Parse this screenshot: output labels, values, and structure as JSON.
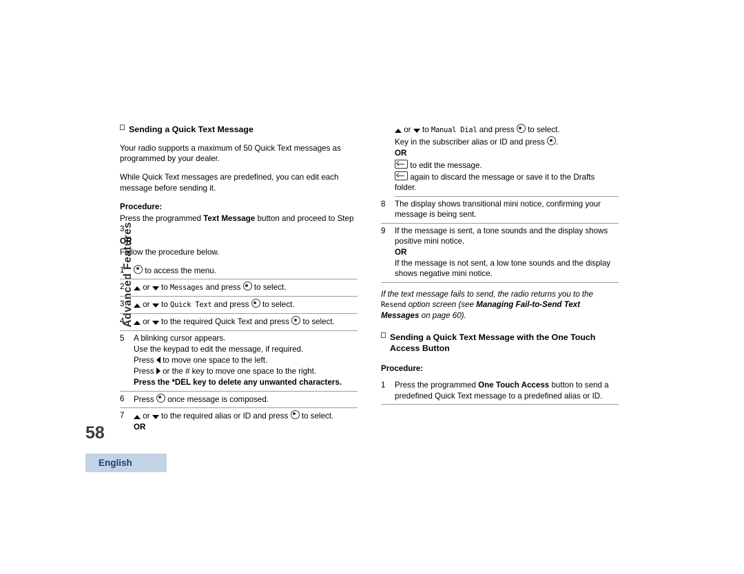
{
  "page": {
    "number": "58",
    "side_tab": "Advanced Features",
    "language_tab": "English"
  },
  "left_column": {
    "section_title": "Sending a Quick Text Message",
    "intro_1": "Your radio supports a maximum of 50 Quick Text messages as programmed by your dealer.",
    "intro_2": "While Quick Text messages are predefined, you can edit each message before sending it.",
    "procedure_label": "Procedure:",
    "proc_intro_a": "Press the programmed ",
    "proc_intro_b": "Text Message",
    "proc_intro_c": " button and proceed to Step 3.",
    "or": "OR",
    "proc_follow": "Follow the procedure below.",
    "steps": [
      {
        "num": "1",
        "text_after_key": " to access the menu."
      },
      {
        "num": "2",
        "pre": " or ",
        "mid": " to ",
        "mono": "Messages",
        "post": " and press ",
        "end": " to select."
      },
      {
        "num": "3",
        "pre": " or ",
        "mid": " to ",
        "mono": "Quick Text",
        "post": " and press ",
        "end": " to select."
      },
      {
        "num": "4",
        "pre": " or ",
        "mid": " to the required Quick Text and press ",
        "end": " to select."
      },
      {
        "num": "5",
        "lines": [
          "A blinking cursor appears.",
          "Use the keypad to edit the message, if required.",
          "Press  to move one space to the left.",
          "Press  or the # key to move one space to the right.",
          "Press the *DEL key to delete any unwanted characters."
        ],
        "line3_a": "Press ",
        "line3_b": " to move one space to the left.",
        "line4_a": "Press ",
        "line4_b": " or the # key to move one space to the right.",
        "line5_bold": "Press the *DEL key to delete any unwanted characters."
      },
      {
        "num": "6",
        "pre": "Press ",
        "post": " once message is composed."
      },
      {
        "num": "7",
        "pre": " or ",
        "mid": " to the required alias or ID and press ",
        "end": " to select.",
        "or": "OR"
      }
    ]
  },
  "right_column": {
    "cont_step7": {
      "pre": " or ",
      "mid": " to ",
      "mono": "Manual Dial",
      "post": " and press ",
      "end": " to select.",
      "line2_a": "Key in the subscriber alias or ID and press ",
      "line2_b": ".",
      "or": "OR",
      "line3_after_key": " to edit the message.",
      "line4_after_key": " again to discard the message or save it to the Drafts folder."
    },
    "steps": [
      {
        "num": "8",
        "text": "The display shows transitional mini notice, confirming your message is being sent."
      },
      {
        "num": "9",
        "text": "If the message is sent, a tone sounds and the display shows positive mini notice.",
        "or": "OR",
        "text2": "If the message is not sent, a low tone sounds and the display shows negative mini notice."
      }
    ],
    "note": {
      "line1": "If the text message fails to send, the radio returns you to the ",
      "mono": "Resend",
      "line2": " option screen (see ",
      "bold": "Managing Fail-to-Send Text Messages",
      "line3": " on page 60)."
    },
    "section2_title": "Sending a Quick Text Message with the One Touch Access Button",
    "procedure_label": "Procedure:",
    "step1": {
      "num": "1",
      "pre": "Press the programmed ",
      "bold": "One Touch Access",
      "post": " button to send a predefined Quick Text message to a predefined alias or ID."
    }
  },
  "colors": {
    "tab_bg": "#c3d2e4",
    "tab_text": "#1c3f73",
    "rule": "#9a9a9a"
  }
}
